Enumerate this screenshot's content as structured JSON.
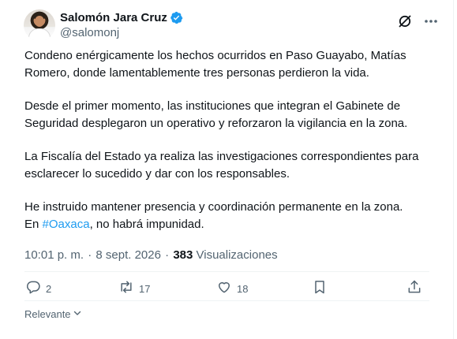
{
  "author": {
    "display_name": "Salomón Jara Cruz",
    "handle": "@salomonj",
    "verified_color": "#1d9bf0"
  },
  "icons": {
    "verified": "verified-badge-icon",
    "grok": "grok-icon",
    "more": "more-options-icon",
    "reply": "reply-icon",
    "repost": "repost-icon",
    "like": "like-icon",
    "bookmark": "bookmark-icon",
    "share": "share-icon",
    "chevron": "chevron-down-icon"
  },
  "tweet": {
    "paragraphs": [
      "Condeno enérgicamente los hechos ocurridos en Paso Guayabo, Matías Romero, donde lamentablemente tres personas perdieron la vida.",
      "Desde el primer momento, las instituciones que integran el Gabinete de Seguridad desplegaron un operativo y reforzaron la vigilancia en la zona.",
      "La Fiscalía del Estado ya realiza las investigaciones correspondientes para esclarecer lo sucedido y dar con los responsables."
    ],
    "last_paragraph": {
      "line1": "He instruido mantener presencia y coordinación permanente en la zona.",
      "prefix": "En ",
      "hashtag": "#Oaxaca",
      "suffix": ", no habrá impunidad."
    },
    "hashtag_color": "#1d9bf0"
  },
  "meta": {
    "time": "10:01 p. m.",
    "separator": "·",
    "date": "8 sept. 2026",
    "views_count": "383",
    "views_label": "Visualizaciones"
  },
  "actions": {
    "replies": "2",
    "reposts": "17",
    "likes": "18"
  },
  "sort": {
    "label": "Relevante"
  }
}
